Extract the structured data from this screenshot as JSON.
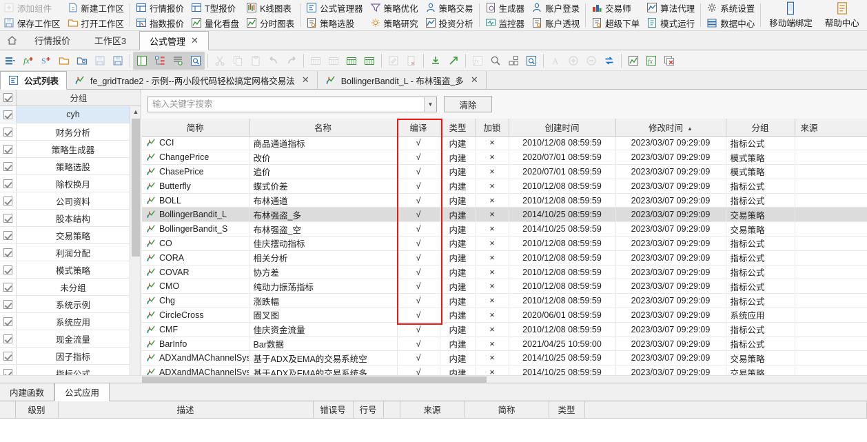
{
  "ribbon": {
    "groups": [
      {
        "type": "stack",
        "items": [
          {
            "label": "添加组件",
            "icon": "add-component-icon",
            "disabled": true
          },
          {
            "label": "保存工作区",
            "icon": "save-workspace-icon",
            "disabled": false
          }
        ]
      },
      {
        "type": "stack",
        "items": [
          {
            "label": "新建工作区",
            "icon": "new-workspace-icon",
            "disabled": false
          },
          {
            "label": "打开工作区",
            "icon": "open-workspace-icon",
            "disabled": false
          }
        ]
      },
      {
        "type": "stack",
        "sep": true,
        "items": [
          {
            "label": "行情报价",
            "icon": "quote-table-icon",
            "disabled": false
          },
          {
            "label": "指数报价",
            "icon": "index-quote-icon",
            "disabled": false
          }
        ]
      },
      {
        "type": "stack",
        "items": [
          {
            "label": "T型报价",
            "icon": "t-quote-icon",
            "disabled": false
          },
          {
            "label": "量化看盘",
            "icon": "quant-board-icon",
            "disabled": false
          }
        ]
      },
      {
        "type": "stack",
        "items": [
          {
            "label": "K线图表",
            "icon": "kline-chart-icon",
            "disabled": false
          },
          {
            "label": "分时图表",
            "icon": "timeshare-chart-icon",
            "disabled": false
          }
        ]
      },
      {
        "type": "stack",
        "sep": true,
        "items": [
          {
            "label": "公式管理器",
            "icon": "formula-manager-icon",
            "disabled": false
          },
          {
            "label": "策略选股",
            "icon": "strategy-pick-icon",
            "disabled": false
          }
        ]
      },
      {
        "type": "stack",
        "items": [
          {
            "label": "策略优化",
            "icon": "strategy-optimize-icon",
            "disabled": false
          },
          {
            "label": "策略研究",
            "icon": "strategy-research-icon",
            "disabled": false
          }
        ]
      },
      {
        "type": "stack",
        "items": [
          {
            "label": "策略交易",
            "icon": "strategy-trade-icon",
            "disabled": false
          },
          {
            "label": "投资分析",
            "icon": "invest-analysis-icon",
            "disabled": false
          }
        ]
      },
      {
        "type": "stack",
        "sep": true,
        "items": [
          {
            "label": "生成器",
            "icon": "generator-icon",
            "disabled": false
          },
          {
            "label": "监控器",
            "icon": "monitor-icon",
            "disabled": false
          }
        ]
      },
      {
        "type": "stack",
        "items": [
          {
            "label": "账户登录",
            "icon": "account-login-icon",
            "disabled": false
          },
          {
            "label": "账户透视",
            "icon": "account-perspective-icon",
            "disabled": false
          }
        ]
      },
      {
        "type": "stack",
        "sep": true,
        "items": [
          {
            "label": "交易师",
            "icon": "trader-icon",
            "disabled": false
          },
          {
            "label": "超级下单",
            "icon": "super-order-icon",
            "disabled": false
          }
        ]
      },
      {
        "type": "stack",
        "items": [
          {
            "label": "算法代理",
            "icon": "algo-agent-icon",
            "disabled": false
          },
          {
            "label": "模式运行",
            "icon": "mode-run-icon",
            "disabled": false
          }
        ]
      },
      {
        "type": "stack",
        "sep": true,
        "items": [
          {
            "label": "系统设置",
            "icon": "system-settings-icon",
            "disabled": false
          },
          {
            "label": "数据中心",
            "icon": "data-center-icon",
            "disabled": false
          }
        ]
      },
      {
        "type": "big",
        "sep": true,
        "label": "移动端绑定",
        "icon": "mobile-bind-icon"
      },
      {
        "type": "big",
        "label": "帮助中心",
        "icon": "help-center-icon"
      }
    ]
  },
  "workspace_tabs": {
    "home_icon": "home-icon",
    "tabs": [
      {
        "label": "行情报价",
        "active": false,
        "closable": false
      },
      {
        "label": "工作区3",
        "active": false,
        "closable": false
      },
      {
        "label": "公式管理",
        "active": true,
        "closable": true,
        "close_glyph": "✕"
      }
    ]
  },
  "icon_toolbar": {
    "buttons": [
      {
        "name": "list-dropdown-icon",
        "selected": false,
        "disabled": false
      },
      {
        "name": "new-function-icon",
        "selected": false,
        "disabled": false
      },
      {
        "name": "new-strategy-icon",
        "selected": false,
        "disabled": false
      },
      {
        "name": "open-folder-icon",
        "selected": false,
        "disabled": false
      },
      {
        "name": "open-attach-icon",
        "selected": false,
        "disabled": false
      },
      {
        "name": "save-icon",
        "selected": false,
        "disabled": true
      },
      {
        "name": "save-all-icon",
        "selected": false,
        "disabled": false
      },
      {
        "sep": true
      },
      {
        "name": "split-view-icon",
        "selected": true,
        "disabled": false
      },
      {
        "name": "tree-view-icon",
        "selected": true,
        "disabled": false
      },
      {
        "name": "outline-view-icon",
        "selected": true,
        "disabled": false
      },
      {
        "name": "inspect-view-icon",
        "selected": true,
        "disabled": false
      },
      {
        "sep": true
      },
      {
        "name": "cut-icon",
        "selected": false,
        "disabled": true
      },
      {
        "name": "copy-icon",
        "selected": false,
        "disabled": true
      },
      {
        "name": "paste-icon",
        "selected": false,
        "disabled": true
      },
      {
        "name": "undo-icon",
        "selected": false,
        "disabled": true
      },
      {
        "name": "redo-icon",
        "selected": false,
        "disabled": true
      },
      {
        "sep": true
      },
      {
        "name": "insert-row-above-icon",
        "selected": false,
        "disabled": true
      },
      {
        "name": "insert-row-below-icon",
        "selected": false,
        "disabled": true
      },
      {
        "name": "add-row-green-icon",
        "selected": false,
        "disabled": false
      },
      {
        "name": "calendar-green-icon",
        "selected": false,
        "disabled": false
      },
      {
        "sep": true
      },
      {
        "name": "edit-icon",
        "selected": false,
        "disabled": true
      },
      {
        "name": "clear-doc-icon",
        "selected": false,
        "disabled": true
      },
      {
        "sep": true
      },
      {
        "name": "import-icon",
        "selected": false,
        "disabled": false
      },
      {
        "name": "export-icon",
        "selected": false,
        "disabled": false
      },
      {
        "sep": true
      },
      {
        "name": "insert-function-icon",
        "selected": false,
        "disabled": true
      },
      {
        "name": "search-icon",
        "selected": false,
        "disabled": false
      },
      {
        "name": "reorder-icon",
        "selected": false,
        "disabled": false
      },
      {
        "name": "preview-icon",
        "selected": false,
        "disabled": false
      },
      {
        "sep": true
      },
      {
        "name": "font-icon",
        "selected": false,
        "disabled": true
      },
      {
        "name": "zoom-in-icon",
        "selected": false,
        "disabled": true
      },
      {
        "name": "zoom-out-icon",
        "selected": false,
        "disabled": true
      },
      {
        "name": "sync-icon",
        "selected": false,
        "disabled": false
      },
      {
        "sep": true
      },
      {
        "name": "chart-formula-icon",
        "selected": false,
        "disabled": false
      },
      {
        "name": "formula-help-icon",
        "selected": false,
        "disabled": false
      },
      {
        "name": "delete-formula-icon",
        "selected": false,
        "disabled": false
      }
    ]
  },
  "document_tabs": [
    {
      "label": "公式列表",
      "icon": "formula-list-icon",
      "active": true,
      "closable": false
    },
    {
      "label": "fe_gridTrade2 - 示例--两小段代码轻松搞定网格交易法",
      "icon": "formula-chart-icon",
      "active": false,
      "closable": true,
      "close_glyph": "✕"
    },
    {
      "label": "BollingerBandit_L - 布林强盗_多",
      "icon": "formula-chart-icon",
      "active": false,
      "closable": true,
      "close_glyph": "✕"
    }
  ],
  "group_panel": {
    "header": "分组",
    "bottom_tabs": [
      {
        "label": "内建函数",
        "active": false
      },
      {
        "label": "公式应用",
        "active": true
      }
    ],
    "items": [
      {
        "label": "cyh",
        "checked": true,
        "selected": true
      },
      {
        "label": "财务分析",
        "checked": true,
        "selected": false
      },
      {
        "label": "策略生成器",
        "checked": true,
        "selected": false
      },
      {
        "label": "策略选股",
        "checked": true,
        "selected": false
      },
      {
        "label": "除权换月",
        "checked": true,
        "selected": false
      },
      {
        "label": "公司资料",
        "checked": true,
        "selected": false
      },
      {
        "label": "股本结构",
        "checked": true,
        "selected": false
      },
      {
        "label": "交易策略",
        "checked": true,
        "selected": false
      },
      {
        "label": "利润分配",
        "checked": true,
        "selected": false
      },
      {
        "label": "模式策略",
        "checked": true,
        "selected": false
      },
      {
        "label": "未分组",
        "checked": true,
        "selected": false
      },
      {
        "label": "系统示例",
        "checked": true,
        "selected": false
      },
      {
        "label": "系统应用",
        "checked": true,
        "selected": false
      },
      {
        "label": "现金流量",
        "checked": true,
        "selected": false
      },
      {
        "label": "因子指标",
        "checked": true,
        "selected": false
      },
      {
        "label": "指标公式",
        "checked": true,
        "selected": false
      }
    ]
  },
  "search": {
    "value": "",
    "placeholder": "输入关键字搜索",
    "dropdown_glyph": "▼",
    "clear_label": "清除"
  },
  "highlight": {
    "color": "#f01414",
    "target_column": "编译"
  },
  "table": {
    "columns": [
      {
        "label": "简称",
        "key": "abbr"
      },
      {
        "label": "名称",
        "key": "name"
      },
      {
        "label": "编译",
        "key": "compile"
      },
      {
        "label": "类型",
        "key": "type"
      },
      {
        "label": "加锁",
        "key": "lock"
      },
      {
        "label": "创建时间",
        "key": "created"
      },
      {
        "label": "修改时间",
        "key": "modified",
        "sorted": true,
        "sort_glyph": "▲"
      },
      {
        "label": "分组",
        "key": "group"
      },
      {
        "label": "来源",
        "key": "source"
      }
    ],
    "rows": [
      {
        "abbr": "CCI",
        "name": "商品通道指标",
        "compile": "√",
        "type": "内建",
        "lock": "×",
        "created": "2010/12/08 08:59:59",
        "modified": "2023/03/07 09:29:09",
        "group": "指标公式",
        "source": "",
        "selected": false
      },
      {
        "abbr": "ChangePrice",
        "name": "改价",
        "compile": "√",
        "type": "内建",
        "lock": "×",
        "created": "2020/07/01 08:59:59",
        "modified": "2023/03/07 09:29:09",
        "group": "模式策略",
        "source": "",
        "selected": false
      },
      {
        "abbr": "ChasePrice",
        "name": "追价",
        "compile": "√",
        "type": "内建",
        "lock": "×",
        "created": "2020/07/01 08:59:59",
        "modified": "2023/03/07 09:29:09",
        "group": "模式策略",
        "source": "",
        "selected": false
      },
      {
        "abbr": "Butterfly",
        "name": "蝶式价差",
        "compile": "√",
        "type": "内建",
        "lock": "×",
        "created": "2010/12/08 08:59:59",
        "modified": "2023/03/07 09:29:09",
        "group": "指标公式",
        "source": "",
        "selected": false
      },
      {
        "abbr": "BOLL",
        "name": "布林通道",
        "compile": "√",
        "type": "内建",
        "lock": "×",
        "created": "2010/12/08 08:59:59",
        "modified": "2023/03/07 09:29:09",
        "group": "指标公式",
        "source": "",
        "selected": false
      },
      {
        "abbr": "BollingerBandit_L",
        "name": "布林强盗_多",
        "compile": "√",
        "type": "内建",
        "lock": "×",
        "created": "2014/10/25 08:59:59",
        "modified": "2023/03/07 09:29:09",
        "group": "交易策略",
        "source": "",
        "selected": true
      },
      {
        "abbr": "BollingerBandit_S",
        "name": "布林强盗_空",
        "compile": "√",
        "type": "内建",
        "lock": "×",
        "created": "2014/10/25 08:59:59",
        "modified": "2023/03/07 09:29:09",
        "group": "交易策略",
        "source": "",
        "selected": false
      },
      {
        "abbr": "CO",
        "name": "佳庆摆动指标",
        "compile": "√",
        "type": "内建",
        "lock": "×",
        "created": "2010/12/08 08:59:59",
        "modified": "2023/03/07 09:29:09",
        "group": "指标公式",
        "source": "",
        "selected": false
      },
      {
        "abbr": "CORA",
        "name": "相关分析",
        "compile": "√",
        "type": "内建",
        "lock": "×",
        "created": "2010/12/08 08:59:59",
        "modified": "2023/03/07 09:29:09",
        "group": "指标公式",
        "source": "",
        "selected": false
      },
      {
        "abbr": "COVAR",
        "name": "协方差",
        "compile": "√",
        "type": "内建",
        "lock": "×",
        "created": "2010/12/08 08:59:59",
        "modified": "2023/03/07 09:29:09",
        "group": "指标公式",
        "source": "",
        "selected": false
      },
      {
        "abbr": "CMO",
        "name": "纯动力振荡指标",
        "compile": "√",
        "type": "内建",
        "lock": "×",
        "created": "2010/12/08 08:59:59",
        "modified": "2023/03/07 09:29:09",
        "group": "指标公式",
        "source": "",
        "selected": false
      },
      {
        "abbr": "Chg",
        "name": "涨跌幅",
        "compile": "√",
        "type": "内建",
        "lock": "×",
        "created": "2010/12/08 08:59:59",
        "modified": "2023/03/07 09:29:09",
        "group": "指标公式",
        "source": "",
        "selected": false
      },
      {
        "abbr": "CircleCross",
        "name": "圈叉图",
        "compile": "√",
        "type": "内建",
        "lock": "×",
        "created": "2020/06/01 08:59:59",
        "modified": "2023/03/07 09:29:09",
        "group": "系统应用",
        "source": "",
        "selected": false
      },
      {
        "abbr": "CMF",
        "name": "佳庆资金流量",
        "compile": "√",
        "type": "内建",
        "lock": "×",
        "created": "2010/12/08 08:59:59",
        "modified": "2023/03/07 09:29:09",
        "group": "指标公式",
        "source": "",
        "selected": false
      },
      {
        "abbr": "BarInfo",
        "name": "Bar数据",
        "compile": "√",
        "type": "内建",
        "lock": "×",
        "created": "2021/04/25 10:59:00",
        "modified": "2023/03/07 09:29:09",
        "group": "指标公式",
        "source": "",
        "selected": false
      },
      {
        "abbr": "ADXandMAChannelSys_S",
        "name": "基于ADX及EMA的交易系统空",
        "compile": "√",
        "type": "内建",
        "lock": "×",
        "created": "2014/10/25 08:59:59",
        "modified": "2023/03/07 09:29:09",
        "group": "交易策略",
        "source": "",
        "selected": false
      },
      {
        "abbr": "ADXandMAChannelSys_L",
        "name": "基于ADX及EMA的交易系统多",
        "compile": "√",
        "type": "内建",
        "lock": "×",
        "created": "2014/10/25 08:59:59",
        "modified": "2023/03/07 09:29:09",
        "group": "交易策略",
        "source": "",
        "selected": false
      }
    ]
  },
  "output_panel": {
    "columns": [
      "",
      "级别",
      "描述",
      "错误号",
      "行号",
      "",
      "来源",
      "简称",
      "类型",
      ""
    ],
    "rows": []
  }
}
